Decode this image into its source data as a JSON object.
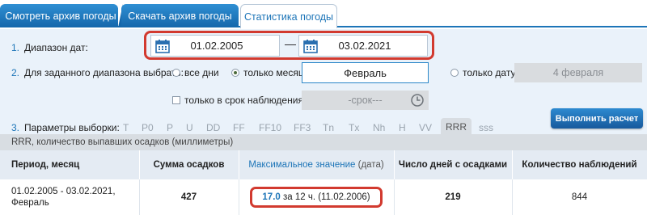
{
  "tabs": [
    {
      "label": "Смотреть архив погоды",
      "active": false
    },
    {
      "label": "Скачать архив погоды",
      "active": false
    },
    {
      "label": "Статистика погоды",
      "active": true
    }
  ],
  "step1": {
    "number": "1.",
    "label": "Диапазон дат:",
    "date_from": "01.02.2005",
    "separator": "—",
    "date_to": "03.02.2021"
  },
  "step2": {
    "number": "2.",
    "label": "Для заданного диапазона выбрать:",
    "opt_all_days": "все дни",
    "opt_month": "только месяц",
    "month_value": "Февраль",
    "opt_date": "только дату",
    "date_value": "4 февраля",
    "opt_obs_time": "только в срок наблюдения",
    "obs_time_placeholder": "-срок---"
  },
  "step3": {
    "number": "3.",
    "label": "Параметры выборки:",
    "params": [
      "T",
      "P0",
      "P",
      "U",
      "DD",
      "FF",
      "FF10",
      "FF3",
      "Tn",
      "Tx",
      "Nh",
      "H",
      "VV",
      "RRR",
      "sss"
    ],
    "active_param": "RRR"
  },
  "calc_button": "Выполнить расчет",
  "result": {
    "caption": "RRR, количество выпавших осадков (миллиметры)",
    "headers": {
      "period": "Период, месяц",
      "sum": "Сумма осадков",
      "max_main": "Максимальное значение",
      "max_sub": "(дата)",
      "days": "Число дней с осадками",
      "count": "Количество наблюдений"
    },
    "row": {
      "period_line1": "01.02.2005 - 03.02.2021,",
      "period_line2": "Февраль",
      "sum": "427",
      "max_value": "17.0",
      "max_rest": "за 12 ч. (11.02.2006)",
      "days": "219",
      "count": "844"
    }
  },
  "colors": {
    "accent": "#1d75b8",
    "highlight": "#d23a2f",
    "panel": "#eaf2fa"
  }
}
